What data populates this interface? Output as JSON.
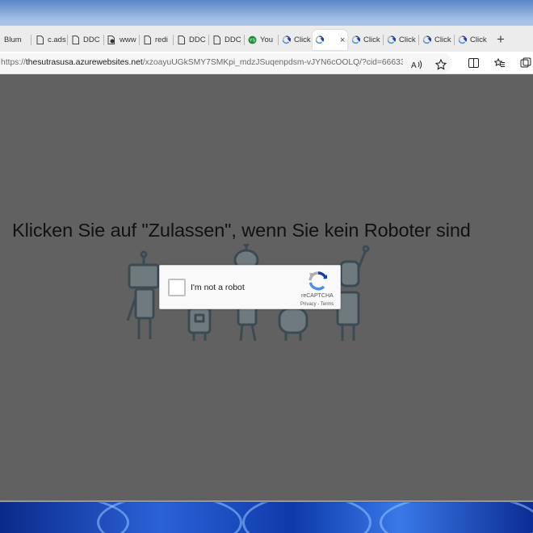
{
  "browser": {
    "tabs": [
      {
        "label": "Blum",
        "icon": "blank-icon"
      },
      {
        "label": "c.ads",
        "icon": "page-icon"
      },
      {
        "label": "DDC",
        "icon": "page-icon"
      },
      {
        "label": "www",
        "icon": "gear-page-icon"
      },
      {
        "label": "redi",
        "icon": "page-icon"
      },
      {
        "label": "DDC",
        "icon": "page-icon"
      },
      {
        "label": "DDC",
        "icon": "page-icon"
      },
      {
        "label": "You",
        "icon": "green-circle-icon"
      },
      {
        "label": "Click",
        "icon": "recaptcha-icon"
      },
      {
        "label": "",
        "icon": "recaptcha-icon",
        "active": true
      },
      {
        "label": "Click",
        "icon": "recaptcha-icon"
      },
      {
        "label": "Click",
        "icon": "recaptcha-icon"
      },
      {
        "label": "Click",
        "icon": "recaptcha-icon"
      },
      {
        "label": "Click",
        "icon": "recaptcha-icon"
      }
    ],
    "close_glyph": "×",
    "new_tab_glyph": "+",
    "address": {
      "scheme": "https://",
      "host": "thesutrasusa.azurewebsites.net",
      "path": "/xzoayuUGkSMY7SMKpi_mdzJSuqenpdsm-vJYN6cOOLQ/?cid=66633..."
    },
    "toolbar_icons": [
      "read-aloud-icon",
      "favorite-star-icon",
      "split-screen-icon",
      "favorites-icon",
      "collections-icon"
    ]
  },
  "page": {
    "headline": "Klicken Sie auf \"Zulassen\", wenn Sie kein Roboter sind",
    "captcha": {
      "label": "I'm not a robot",
      "brand": "reCAPTCHA",
      "links": "Privacy - Terms"
    }
  },
  "colors": {
    "overlay": "#545454",
    "recaptcha_blue": "#1c3aa9",
    "recaptcha_light": "#4a90e2",
    "recaptcha_grey": "#b0b0b0",
    "robot_stroke": "#3c4a52"
  }
}
